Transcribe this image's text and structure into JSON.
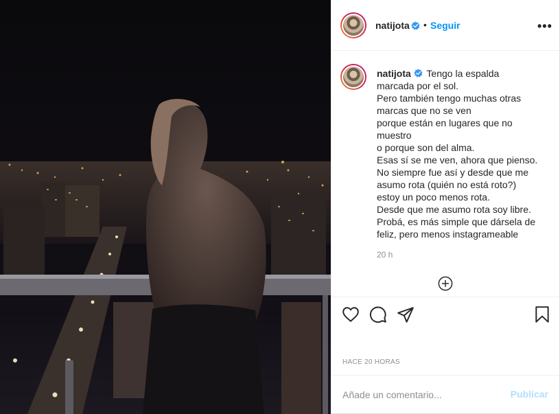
{
  "header": {
    "username": "natijota",
    "separator": "•",
    "follow_label": "Seguir",
    "more_label": "•••"
  },
  "caption": {
    "username": "natijota",
    "text": " Tengo la espalda marcada por el sol.\nPero también tengo muchas otras marcas que no se ven\nporque están en lugares que no muestro\no porque son del alma.\nEsas sí se me ven, ahora que pienso.\nNo siempre fue así y desde que me asumo rota (quién no está roto?) estoy un poco menos rota.\nDesde que me asumo rota soy libre.\nProbá, es más simple que dársela de feliz, pero menos instagrameable",
    "time": "20 h"
  },
  "post": {
    "time_upper": "HACE 20 HORAS"
  },
  "comment": {
    "placeholder": "Añade un comentario...",
    "publish_label": "Publicar"
  },
  "icons": {
    "verified": "verified-badge-icon",
    "more": "more-options-icon",
    "add": "load-more-comments-icon",
    "like": "heart-icon",
    "comment": "comment-icon",
    "share": "share-icon",
    "save": "bookmark-icon"
  },
  "colors": {
    "accent": "#0095f6",
    "verified": "#3897f0",
    "muted": "#8e8e8e",
    "publish_disabled": "#b2dffc"
  }
}
